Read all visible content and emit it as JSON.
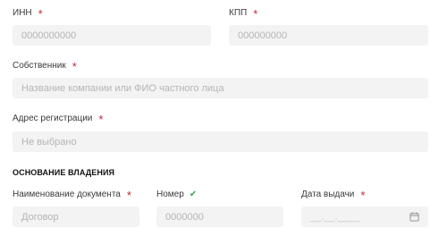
{
  "form": {
    "inn": {
      "label": "ИНН",
      "placeholder": "0000000000",
      "value": ""
    },
    "kpp": {
      "label": "КПП",
      "placeholder": "000000000",
      "value": ""
    },
    "owner": {
      "label": "Собственник",
      "placeholder": "Название компании или ФИО частного лица",
      "value": ""
    },
    "address": {
      "label": "Адрес регистрации",
      "placeholder": "Не выбрано",
      "value": ""
    },
    "ownership_section": "ОСНОВАНИЕ ВЛАДЕНИЯ",
    "doc_name": {
      "label": "Наименование документа",
      "placeholder": "Договор",
      "value": ""
    },
    "number": {
      "label": "Номер",
      "placeholder": "0000000",
      "value": ""
    },
    "issue_date": {
      "label": "Дата выдачи",
      "placeholder": "__.__.____"
    }
  },
  "required_mark": "*",
  "valid_mark": "✔",
  "icons": {
    "calendar": "calendar-icon"
  },
  "colors": {
    "required": "#c0273a",
    "valid": "#3aa94b",
    "field_bg": "#f3f3f3"
  }
}
